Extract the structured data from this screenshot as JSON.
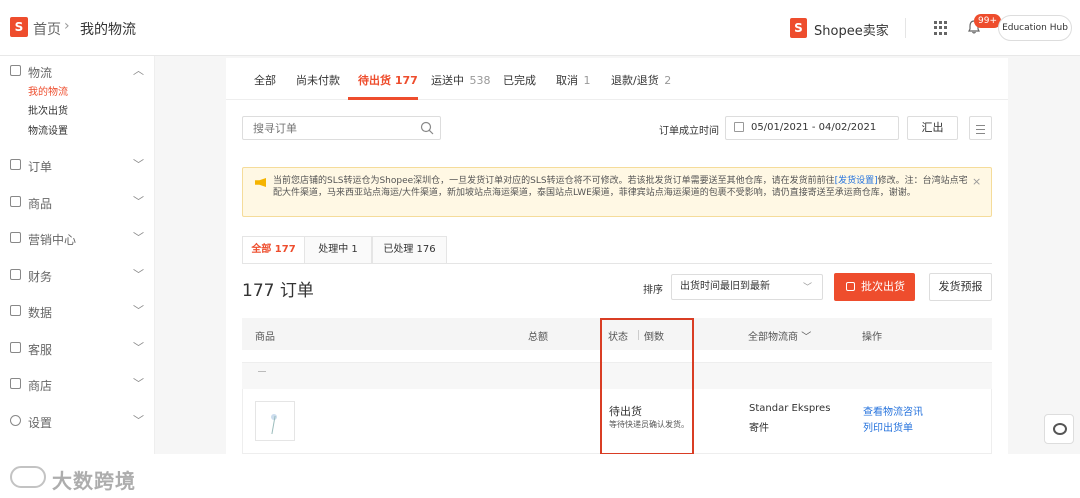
{
  "header": {
    "breadcrumb_home": "首页",
    "breadcrumb_sep": "›",
    "breadcrumb_current": "我的物流",
    "seller_center": "Shopee卖家",
    "notification_badge": "99+",
    "education_hub": "Education Hub"
  },
  "sidebar": {
    "groups": [
      {
        "label": "物流",
        "icon": "logistics-icon",
        "expanded": true
      },
      {
        "label": "订单",
        "icon": "order-icon"
      },
      {
        "label": "商品",
        "icon": "product-icon"
      },
      {
        "label": "营销中心",
        "icon": "marketing-icon"
      },
      {
        "label": "财务",
        "icon": "finance-icon"
      },
      {
        "label": "数据",
        "icon": "data-icon"
      },
      {
        "label": "客服",
        "icon": "customer-service-icon"
      },
      {
        "label": "商店",
        "icon": "shop-icon"
      },
      {
        "label": "设置",
        "icon": "settings-icon"
      }
    ],
    "logistics_items": [
      {
        "label": "我的物流",
        "active": true
      },
      {
        "label": "批次出货"
      },
      {
        "label": "物流设置"
      }
    ]
  },
  "tabs": [
    {
      "label": "全部",
      "count": ""
    },
    {
      "label": "尚未付款",
      "count": ""
    },
    {
      "label": "待出货",
      "count": "177",
      "active": true
    },
    {
      "label": "运送中",
      "count": "538"
    },
    {
      "label": "已完成",
      "count": ""
    },
    {
      "label": "取消",
      "count": "1"
    },
    {
      "label": "退款/退货",
      "count": "2"
    }
  ],
  "filters": {
    "search_placeholder": "搜寻订单",
    "date_label": "订单成立时间",
    "date_range": "05/01/2021 - 04/02/2021",
    "export_label": "汇出"
  },
  "notice": {
    "text_before_link": "当前您店铺的SLS转运仓为Shopee深圳仓，一旦发货订单对应的SLS转运仓将不可修改。若该批发货订单需要送至其他仓库，请在发货前前往",
    "link": "[发货设置]",
    "text_after_link": "修改。注：台湾站点宅配大件渠道，马来西亚站点海运/大件渠道，新加坡站点海运渠道，泰国站点LWE渠道，菲律宾站点海运渠道的包裹不受影响，请仍直接寄送至承运商仓库，谢谢。",
    "close": "×"
  },
  "subtabs": [
    {
      "label": "全部 177",
      "active": true
    },
    {
      "label": "处理中 1"
    },
    {
      "label": "已处理 176"
    }
  ],
  "orders": {
    "count_label": "177 订单",
    "sort_label": "排序",
    "sort_value": "出货时间最旧到最新",
    "mass_ship_label": "批次出货",
    "preview_label": "发货预报"
  },
  "table": {
    "headers": {
      "product": "商品",
      "total": "总额",
      "status": "状态",
      "countdown": "倒数",
      "carrier": "全部物流商",
      "action": "操作"
    },
    "separator": "—",
    "rows": [
      {
        "status": "待出货",
        "status_note": "等待快递员确认发货。",
        "carrier": "Standar Ekspres",
        "carrier_type": "寄件",
        "actions": [
          "查看物流咨讯",
          "列印出货单"
        ]
      }
    ]
  },
  "watermark": "大数跨境",
  "colors": {
    "brand": "#ee4d2d",
    "link": "#2673dd",
    "notice_bg": "#fff8e4",
    "highlight": "#d93d24"
  }
}
